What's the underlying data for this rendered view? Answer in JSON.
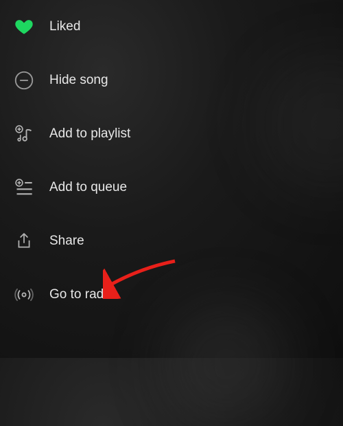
{
  "menu": {
    "items": [
      {
        "label": "Liked"
      },
      {
        "label": "Hide song"
      },
      {
        "label": "Add to playlist"
      },
      {
        "label": "Add to queue"
      },
      {
        "label": "Share"
      },
      {
        "label": "Go to radio"
      }
    ]
  },
  "colors": {
    "liked": "#1ed760",
    "icon": "#b3b3b3",
    "arrow": "#e8201a"
  }
}
